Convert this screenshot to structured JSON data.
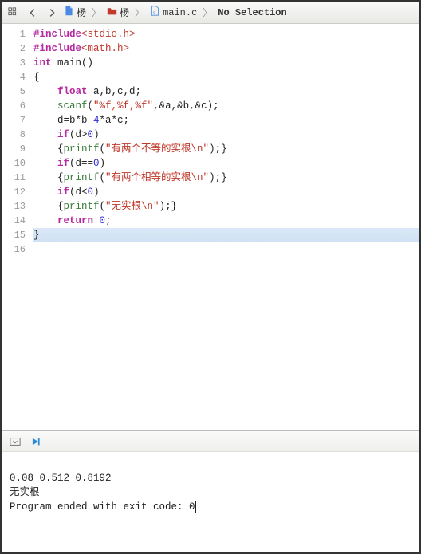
{
  "toolbar": {
    "crumb1": "杨",
    "crumb2": "杨",
    "crumb3": "main.c",
    "no_selection": "No Selection"
  },
  "code": {
    "lines": [
      {
        "n": 1,
        "segs": [
          {
            "c": "ppkw",
            "t": "#include"
          },
          {
            "c": "inc",
            "t": "<stdio.h>"
          }
        ]
      },
      {
        "n": 2,
        "segs": [
          {
            "c": "ppkw",
            "t": "#include"
          },
          {
            "c": "inc",
            "t": "<math.h>"
          }
        ]
      },
      {
        "n": 3,
        "segs": [
          {
            "c": "typ",
            "t": "int"
          },
          {
            "c": "",
            "t": " main()"
          }
        ]
      },
      {
        "n": 4,
        "segs": [
          {
            "c": "",
            "t": "{"
          }
        ]
      },
      {
        "n": 5,
        "segs": [
          {
            "c": "",
            "t": "    "
          },
          {
            "c": "typ",
            "t": "float"
          },
          {
            "c": "",
            "t": " a,b,c,d;"
          }
        ]
      },
      {
        "n": 6,
        "segs": [
          {
            "c": "",
            "t": "    "
          },
          {
            "c": "fn",
            "t": "scanf"
          },
          {
            "c": "",
            "t": "("
          },
          {
            "c": "str",
            "t": "\"%f,%f,%f\""
          },
          {
            "c": "",
            "t": ",&a,&b,&c);"
          }
        ]
      },
      {
        "n": 7,
        "segs": [
          {
            "c": "",
            "t": "    d=b*b-"
          },
          {
            "c": "num",
            "t": "4"
          },
          {
            "c": "",
            "t": "*a*c;"
          }
        ]
      },
      {
        "n": 8,
        "segs": [
          {
            "c": "",
            "t": "    "
          },
          {
            "c": "kw",
            "t": "if"
          },
          {
            "c": "",
            "t": "(d>"
          },
          {
            "c": "num",
            "t": "0"
          },
          {
            "c": "",
            "t": ")"
          }
        ]
      },
      {
        "n": 9,
        "segs": [
          {
            "c": "",
            "t": "    {"
          },
          {
            "c": "fn",
            "t": "printf"
          },
          {
            "c": "",
            "t": "("
          },
          {
            "c": "str",
            "t": "\"有两个不等的实根\\n\""
          },
          {
            "c": "",
            "t": ");}"
          }
        ]
      },
      {
        "n": 10,
        "segs": [
          {
            "c": "",
            "t": "    "
          },
          {
            "c": "kw",
            "t": "if"
          },
          {
            "c": "",
            "t": "(d=="
          },
          {
            "c": "num",
            "t": "0"
          },
          {
            "c": "",
            "t": ")"
          }
        ]
      },
      {
        "n": 11,
        "segs": [
          {
            "c": "",
            "t": "    {"
          },
          {
            "c": "fn",
            "t": "printf"
          },
          {
            "c": "",
            "t": "("
          },
          {
            "c": "str",
            "t": "\"有两个相等的实根\\n\""
          },
          {
            "c": "",
            "t": ");}"
          }
        ]
      },
      {
        "n": 12,
        "segs": [
          {
            "c": "",
            "t": "    "
          },
          {
            "c": "kw",
            "t": "if"
          },
          {
            "c": "",
            "t": "(d<"
          },
          {
            "c": "num",
            "t": "0"
          },
          {
            "c": "",
            "t": ")"
          }
        ]
      },
      {
        "n": 13,
        "segs": [
          {
            "c": "",
            "t": "    {"
          },
          {
            "c": "fn",
            "t": "printf"
          },
          {
            "c": "",
            "t": "("
          },
          {
            "c": "str",
            "t": "\"无实根\\n\""
          },
          {
            "c": "",
            "t": ");}"
          }
        ]
      },
      {
        "n": 14,
        "segs": [
          {
            "c": "",
            "t": "    "
          },
          {
            "c": "kw",
            "t": "return"
          },
          {
            "c": "",
            "t": " "
          },
          {
            "c": "num",
            "t": "0"
          },
          {
            "c": "",
            "t": ";"
          }
        ]
      },
      {
        "n": 15,
        "segs": [
          {
            "c": "",
            "t": "}"
          }
        ],
        "hl": true
      },
      {
        "n": 16,
        "segs": [
          {
            "c": "",
            "t": ""
          }
        ]
      }
    ]
  },
  "console": {
    "line1": "0.08 0.512 0.8192",
    "line2": "无实根",
    "line3": "Program ended with exit code: 0"
  }
}
